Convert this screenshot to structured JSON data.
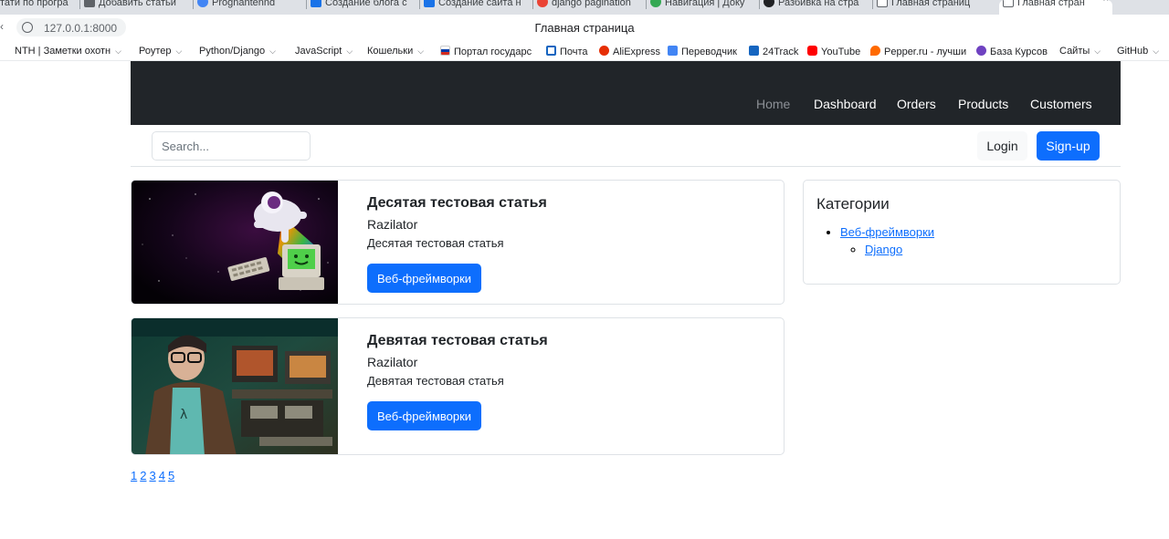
{
  "browser": {
    "tabs": [
      {
        "label": "тати по програ",
        "color": "#ffffff"
      },
      {
        "label": "Добавить статьи",
        "color": "#5f6368"
      },
      {
        "label": "Prognantennd",
        "color": "#4285f4"
      },
      {
        "label": "Создание блога с",
        "color": "#1a73e8"
      },
      {
        "label": "Создание сайта н",
        "color": "#1a73e8"
      },
      {
        "label": "django pagination",
        "color": "#ea4335"
      },
      {
        "label": "Навигация | Доку",
        "color": "#34a853"
      },
      {
        "label": "Разбивка на стра",
        "color": "#202124"
      },
      {
        "label": "Главная страниц",
        "color": "#5f6368"
      },
      {
        "label": "Главная стран",
        "color": "#5f6368"
      }
    ],
    "url": "127.0.0.1:8000",
    "title": "Главная страница",
    "bookmarks": [
      {
        "label": "NTH | Заметки охотн",
        "icon": "",
        "color": "",
        "dropdown": true
      },
      {
        "label": "Роутер",
        "icon": "",
        "color": "",
        "dropdown": true
      },
      {
        "label": "Python/Django",
        "icon": "",
        "color": "",
        "dropdown": true
      },
      {
        "label": "JavaScript",
        "icon": "",
        "color": "",
        "dropdown": true
      },
      {
        "label": "Кошельки",
        "icon": "",
        "color": "",
        "dropdown": true
      },
      {
        "label": "Портал государс",
        "icon": "flag-icon",
        "color": "#d52b1e",
        "dropdown": false
      },
      {
        "label": "Почта",
        "icon": "mail-icon",
        "color": "#1565c0",
        "dropdown": false
      },
      {
        "label": "AliExpress",
        "icon": "aliexpress-icon",
        "color": "#e62e04",
        "dropdown": false
      },
      {
        "label": "Переводчик",
        "icon": "translate-icon",
        "color": "#4285f4",
        "dropdown": false
      },
      {
        "label": "24Track",
        "icon": "tracking-icon",
        "color": "#1565c0",
        "dropdown": false
      },
      {
        "label": "YouTube",
        "icon": "youtube-icon",
        "color": "#ff0000",
        "dropdown": false
      },
      {
        "label": "Pepper.ru - лучши",
        "icon": "fire-icon",
        "color": "#ff6a00",
        "dropdown": false
      },
      {
        "label": "База Курсов",
        "icon": "book-icon",
        "color": "#6f42c1",
        "dropdown": false
      },
      {
        "label": "Сайты",
        "icon": "",
        "color": "",
        "dropdown": true
      },
      {
        "label": "GitHub",
        "icon": "",
        "color": "",
        "dropdown": true
      }
    ]
  },
  "nav": {
    "links": [
      "Home",
      "Dashboard",
      "Orders",
      "Products",
      "Customers"
    ]
  },
  "search": {
    "placeholder": "Search..."
  },
  "auth": {
    "login": "Login",
    "signup": "Sign-up"
  },
  "articles": [
    {
      "title": "Десятая тестовая статья",
      "author": "Razilator",
      "excerpt": "Десятая тестовая статья",
      "category": "Веб-фреймворки",
      "image": "astronaut-computer-illustration"
    },
    {
      "title": "Девятая тестовая статья",
      "author": "Razilator",
      "excerpt": "Девятая тестовая статья",
      "category": "Веб-фреймворки",
      "image": "man-with-retro-computers-photo"
    }
  ],
  "sidebar": {
    "title": "Категории",
    "categories": [
      {
        "name": "Веб-фреймворки",
        "children": [
          {
            "name": "Django"
          }
        ]
      }
    ]
  },
  "pagination": {
    "pages": [
      "1",
      "2",
      "3",
      "4",
      "5"
    ]
  },
  "colors": {
    "accent": "#0d6efd",
    "navbar": "#212529"
  }
}
